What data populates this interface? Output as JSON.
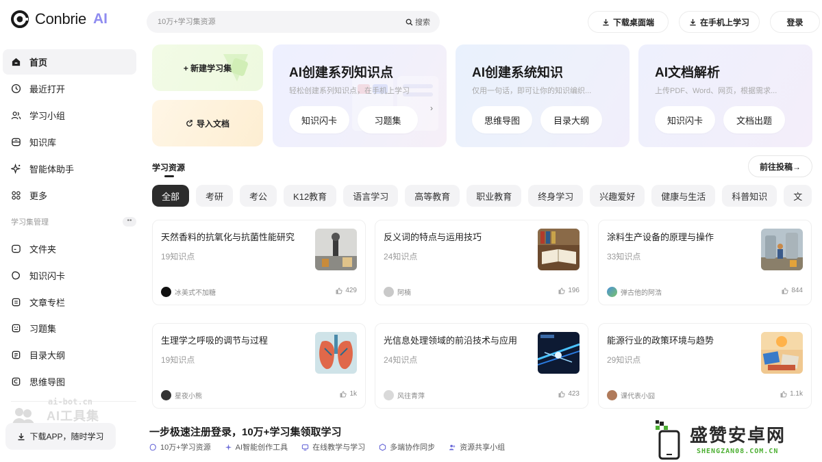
{
  "logo": {
    "name": "Conbrie",
    "suffix": "AI"
  },
  "nav": [
    {
      "label": "首页",
      "icon": "home-icon"
    },
    {
      "label": "最近打开",
      "icon": "clock-icon"
    },
    {
      "label": "学习小组",
      "icon": "users-icon"
    },
    {
      "label": "知识库",
      "icon": "database-icon"
    },
    {
      "label": "智能体助手",
      "icon": "sparkle-icon"
    },
    {
      "label": "更多",
      "icon": "grid-icon"
    }
  ],
  "section_title": "学习集管理",
  "section_more": "••",
  "nav2": [
    {
      "label": "文件夹",
      "icon": "folder-icon"
    },
    {
      "label": "知识闪卡",
      "icon": "flashcard-icon"
    },
    {
      "label": "文章专栏",
      "icon": "article-icon"
    },
    {
      "label": "习题集",
      "icon": "quiz-icon"
    },
    {
      "label": "目录大纲",
      "icon": "outline-icon"
    },
    {
      "label": "思维导图",
      "icon": "mindmap-icon"
    }
  ],
  "watermark_left": {
    "line1": "ai-bot.cn",
    "line2": "AI工具集"
  },
  "download_app": "下载APP，随时学习",
  "search": {
    "placeholder": "10万+学习集资源",
    "button": "搜索"
  },
  "top_buttons": {
    "download_desktop": "下载桌面端",
    "mobile_learn": "在手机上学习",
    "login": "登录"
  },
  "mini_cards": {
    "new_set": "+ 新建学习集",
    "import_doc": "导入文档"
  },
  "features": [
    {
      "title": "AI创建系列知识点",
      "subtitle": "轻松创建系列知识点，在手机上学习",
      "buttons": [
        "知识闪卡",
        "习题集"
      ]
    },
    {
      "title": "AI创建系统知识",
      "subtitle": "仅用一句话，即可让你的知识编织...",
      "buttons": [
        "思维导图",
        "目录大纲"
      ]
    },
    {
      "title": "AI文档解析",
      "subtitle": "上传PDF、Word、网页，根据需求...",
      "buttons": [
        "知识闪卡",
        "文档出题"
      ]
    }
  ],
  "resources": {
    "title": "学习资源",
    "go_post": "前往投稿→"
  },
  "categories": [
    "全部",
    "考研",
    "考公",
    "K12教育",
    "语言学习",
    "高等教育",
    "职业教育",
    "终身学习",
    "兴趣爱好",
    "健康与生活",
    "科普知识",
    "文"
  ],
  "cards": [
    {
      "title": "天然香料的抗氧化与抗菌性能研究",
      "count": "19知识点",
      "author": "冰美式不加糖",
      "likes": "429"
    },
    {
      "title": "反义词的特点与运用技巧",
      "count": "24知识点",
      "author": "阿楠",
      "likes": "196"
    },
    {
      "title": "涂料生产设备的原理与操作",
      "count": "33知识点",
      "author": "弹古他的阿浩",
      "likes": "844"
    },
    {
      "title": "生理学之呼吸的调节与过程",
      "count": "19知识点",
      "author": "星夜小熊",
      "likes": "1k"
    },
    {
      "title": "光信息处理领域的前沿技术与应用",
      "count": "24知识点",
      "author": "风往青萍",
      "likes": "423"
    },
    {
      "title": "能源行业的政策环境与趋势",
      "count": "29知识点",
      "author": "课代表小囧",
      "likes": "1.1k"
    }
  ],
  "promo": {
    "title": "一步极速注册登录，10万+学习集领取学习",
    "items": [
      "10万+学习资源",
      "AI智能创作工具",
      "在线教学与学习",
      "多端协作同步",
      "资源共享小组"
    ]
  },
  "watermark_right": {
    "cn": "盛赞安卓网",
    "en": "SHENGZAN08.COM.CN"
  },
  "colors": {
    "accent": "#8f8cf0",
    "dark": "#2c2c2c",
    "green": "#4caf32"
  }
}
